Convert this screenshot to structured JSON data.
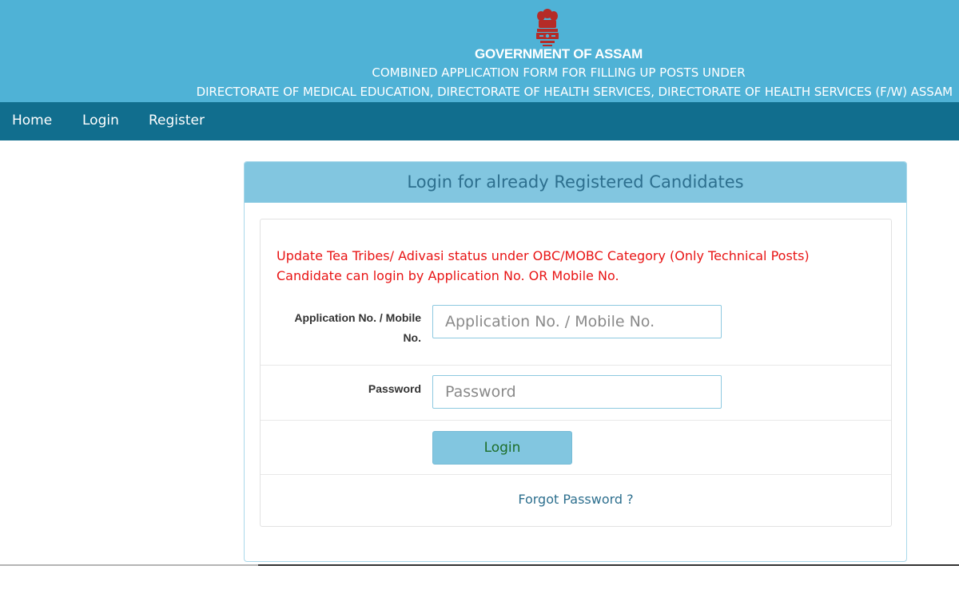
{
  "header": {
    "emblem": "state-emblem-icon",
    "title": "GOVERNMENT OF ASSAM",
    "subtitle": "COMBINED APPLICATION FORM FOR FILLING UP POSTS UNDER",
    "directorates": "DIRECTORATE OF MEDICAL EDUCATION, DIRECTORATE OF HEALTH SERVICES, DIRECTORATE OF HEALTH SERVICES (F/W) ASSAM",
    "background_color": "#4fb2d6"
  },
  "nav": {
    "background_color": "#116e8e",
    "items": [
      {
        "label": "Home"
      },
      {
        "label": "Login"
      },
      {
        "label": "Register"
      }
    ]
  },
  "login_panel": {
    "heading": "Login for already Registered Candidates",
    "notice_line1": "Update Tea Tribes/ Adivasi status under OBC/MOBC Category (Only Technical Posts)",
    "notice_line2": "Candidate can login by Application No. OR Mobile No.",
    "notice_color": "#e81414",
    "app_no_label_line1": "Application No. / Mobile",
    "app_no_label_line2": "No.",
    "app_no_value": "",
    "app_no_placeholder": "Application No. / Mobile No.",
    "password_label": "Password",
    "password_value": "",
    "password_placeholder": "Password",
    "login_button": "Login",
    "forgot_password": "Forgot Password ?"
  }
}
